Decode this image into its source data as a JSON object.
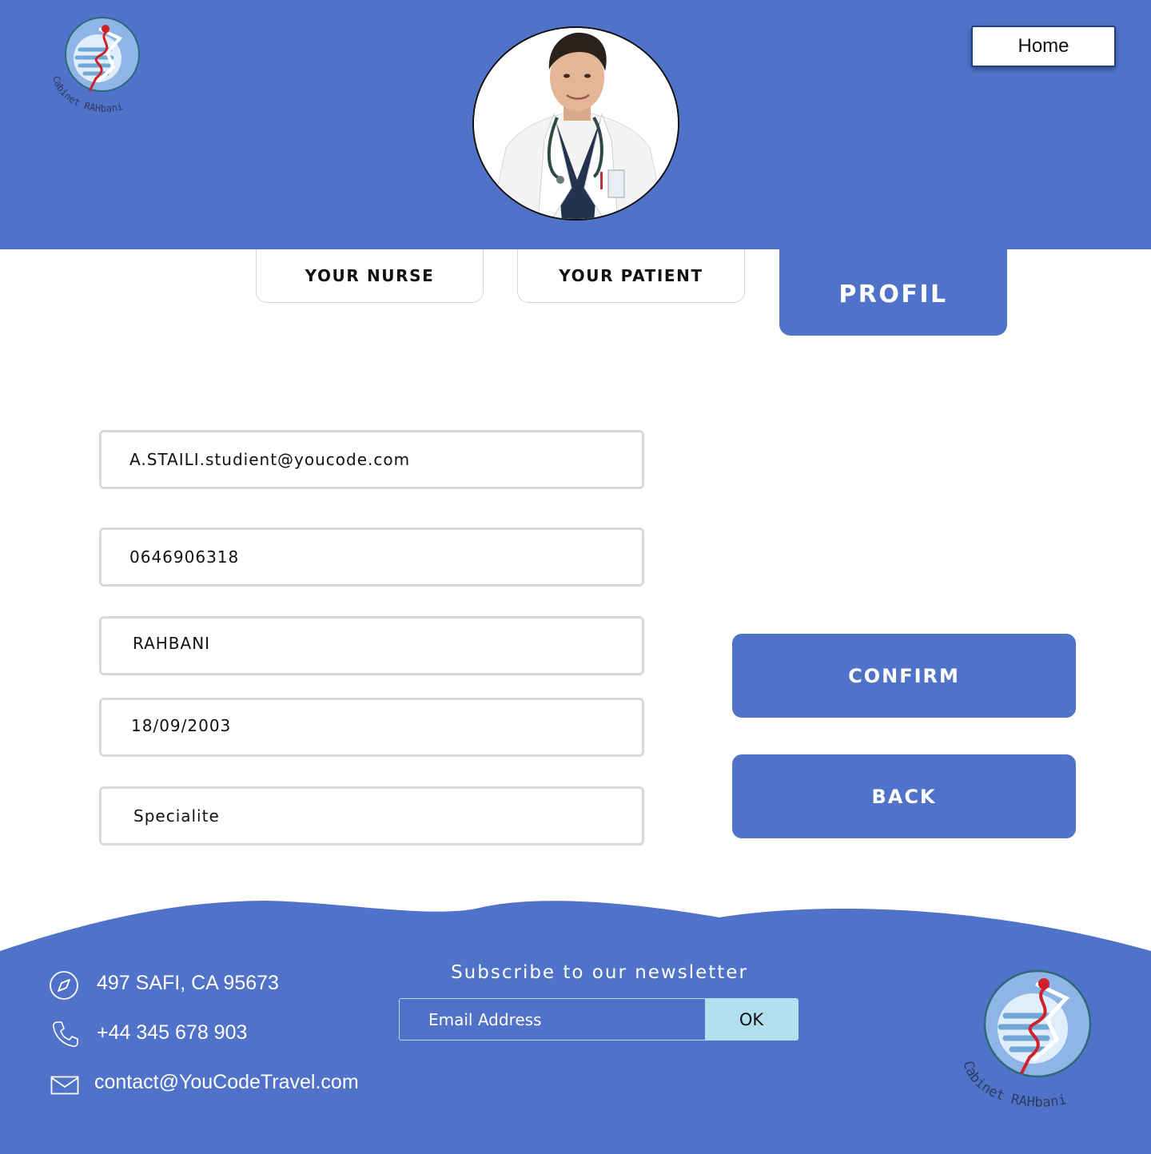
{
  "header": {
    "logo_text": "Cabinet RAHbani",
    "home_label": "Home"
  },
  "tabs": {
    "nurse": "YOUR NURSE",
    "patient": "YOUR PATIENT",
    "profil": "PROFIL"
  },
  "form": {
    "email": "A.STAILI.studient@youcode.com",
    "phone": "0646906318",
    "name": "RAHBANI",
    "birthdate": "18/09/2003",
    "specialite": "Specialite"
  },
  "actions": {
    "confirm": "CONFIRM",
    "back": "BACK"
  },
  "footer": {
    "address": "497  SAFI, CA 95673",
    "phone": "+44 345 678 903",
    "email": "contact@YouCodeTravel.com",
    "newsletter_title": "Subscribe to our newsletter",
    "newsletter_placeholder": "Email Address",
    "ok_label": "OK",
    "logo_text": "Cabinet RAHbani"
  },
  "colors": {
    "brand": "#5072c8",
    "accent_light": "#b3e0ee"
  }
}
